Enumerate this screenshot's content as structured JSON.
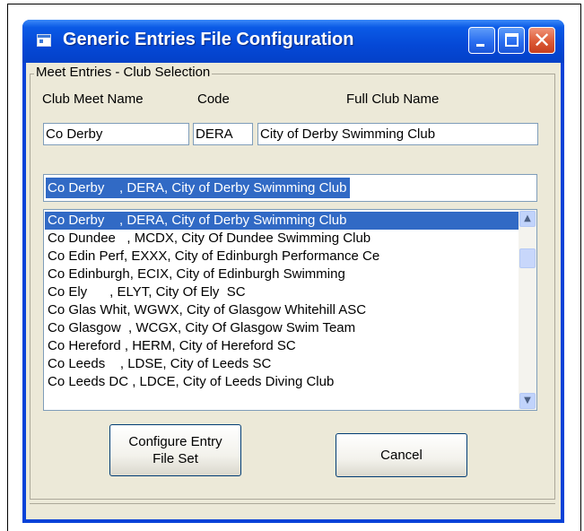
{
  "window": {
    "title": "Generic Entries File Configuration",
    "accent": "#0842d8"
  },
  "group": {
    "legend": "Meet Entries -  Club Selection"
  },
  "headers": {
    "meet_name": "Club Meet Name",
    "code": "Code",
    "full_name": "Full Club Name"
  },
  "fields": {
    "meet_name": "Co Derby",
    "code": "DERA",
    "full_name": "City of Derby Swimming Club"
  },
  "combo": {
    "selected": "Co Derby    , DERA, City of Derby Swimming Club"
  },
  "list": {
    "items": [
      "Co Derby    , DERA, City of Derby Swimming Club",
      "Co Dundee   , MCDX, City Of Dundee Swimming Club",
      "Co Edin Perf, EXXX, City of Edinburgh Performance Ce",
      "Co Edinburgh, ECIX, City of Edinburgh Swimming",
      "Co Ely      , ELYT, City Of Ely  SC",
      "Co Glas Whit, WGWX, City of Glasgow Whitehill ASC",
      "Co Glasgow  , WCGX, City Of Glasgow Swim Team",
      "Co Hereford , HERM, City of Hereford SC",
      "Co Leeds    , LDSE, City of Leeds SC",
      "Co Leeds DC , LDCE, City of Leeds Diving Club"
    ],
    "selected_index": 0
  },
  "buttons": {
    "configure_line1": "Configure Entry",
    "configure_line2": "File Set",
    "cancel": "Cancel"
  }
}
